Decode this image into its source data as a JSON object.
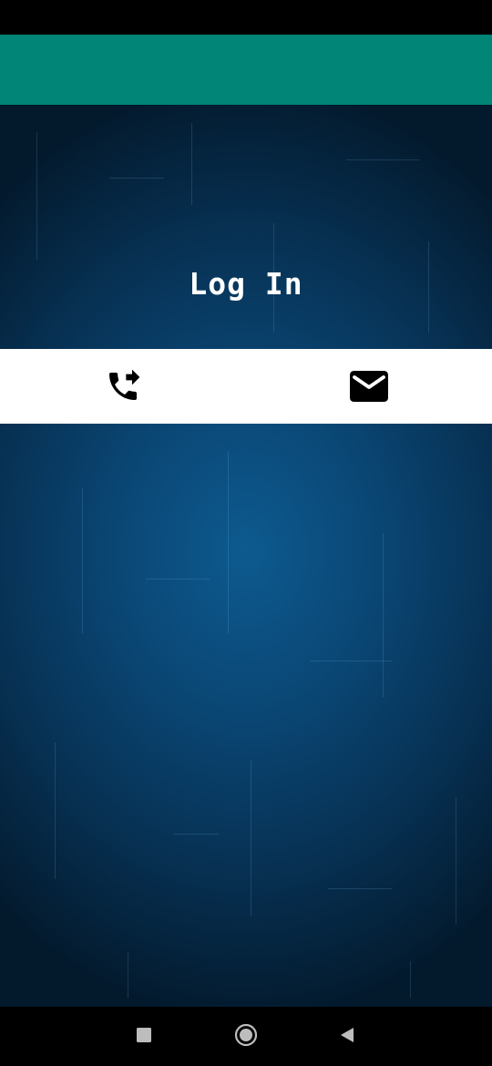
{
  "app_bar": {
    "color": "#018577"
  },
  "login": {
    "title": "Log In"
  },
  "tabs": [
    {
      "icon": "phone-forwarded-icon"
    },
    {
      "icon": "email-icon"
    }
  ],
  "nav": {
    "recents_icon": "square-icon",
    "home_icon": "circle-icon",
    "back_icon": "triangle-back-icon"
  }
}
